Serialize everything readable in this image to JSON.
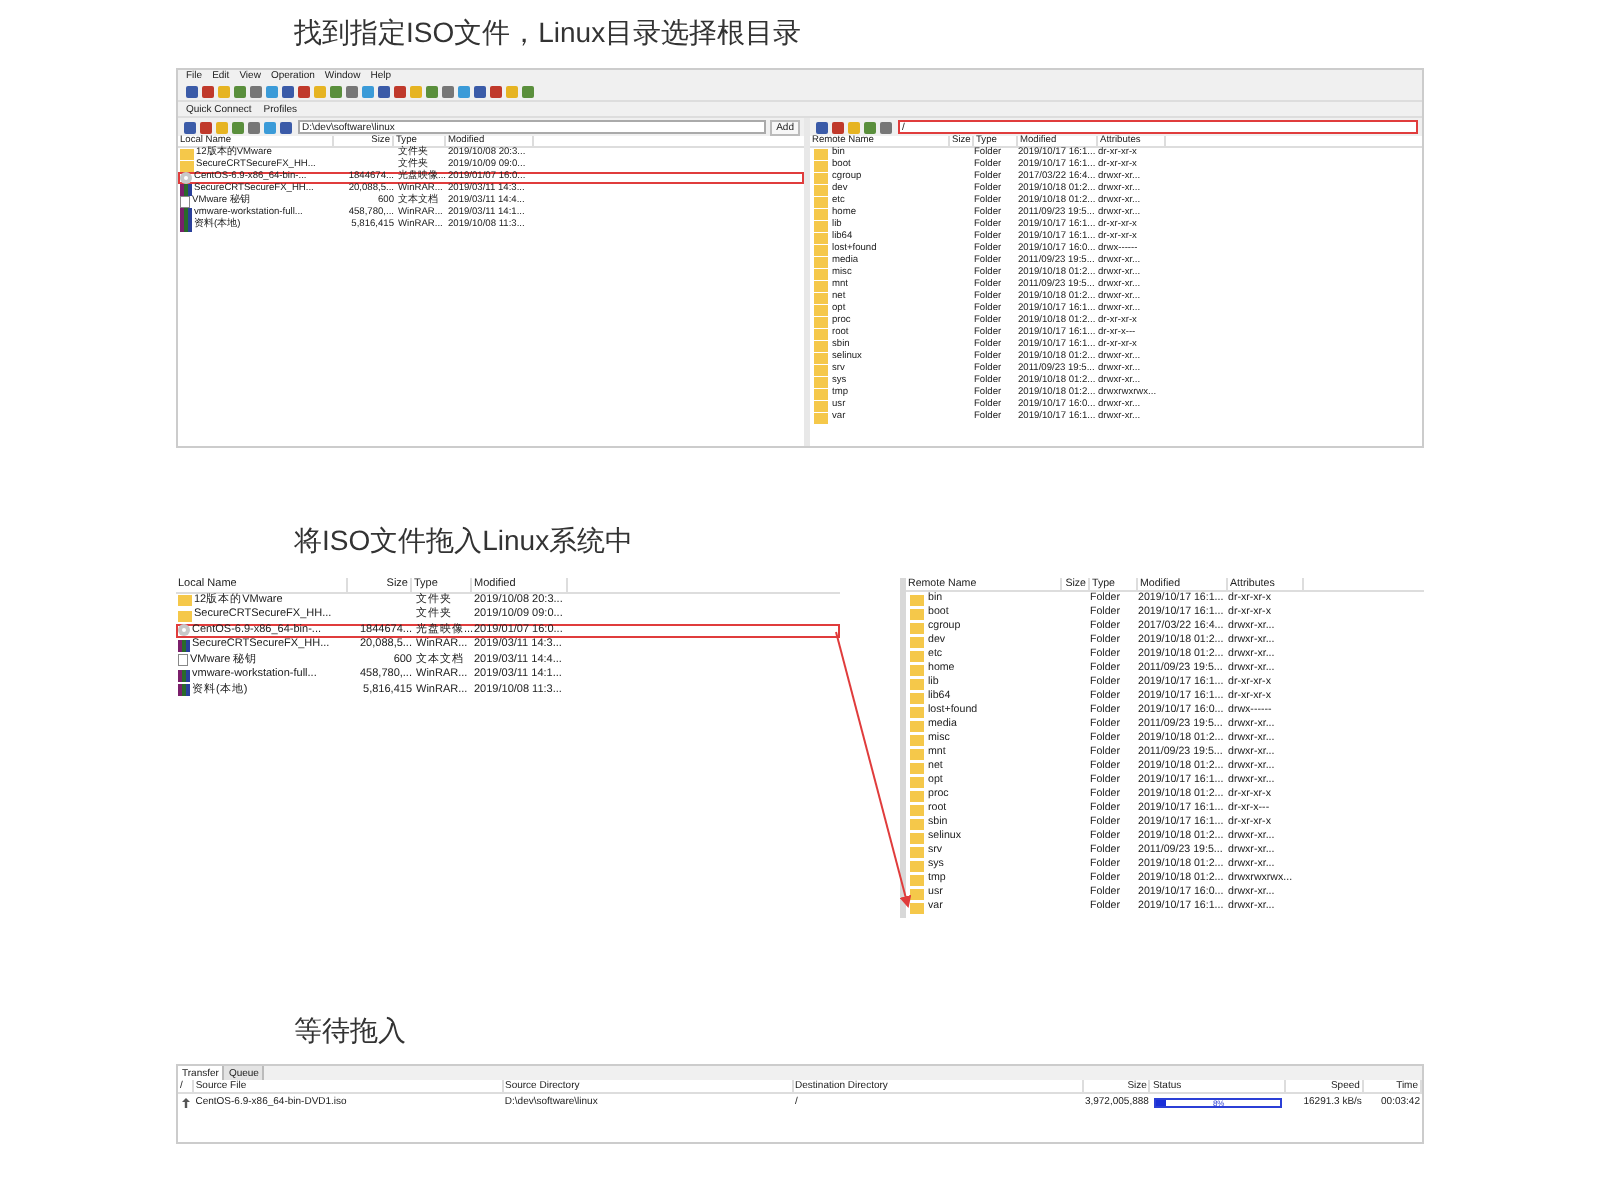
{
  "step1": {
    "heading": "找到指定ISO文件，Linux目录选择根目录",
    "menu": [
      "File",
      "Edit",
      "View",
      "Operation",
      "Window",
      "Help"
    ],
    "quick_connect": "Quick Connect",
    "profiles": "Profiles",
    "local_path": "D:\\dev\\software\\linux",
    "add_button": "Add",
    "remote_path": "/",
    "remote_path_highlighted": true,
    "local_columns": [
      "Local Name",
      "Size",
      "Type",
      "Modified"
    ],
    "local_files": [
      {
        "name": "12版本的VMware",
        "type": "文件夹",
        "modified": "2019/10/08 20:3...",
        "kind": "folder",
        "highlighted": false
      },
      {
        "name": "SecureCRTSecureFX_HH...",
        "type": "文件夹",
        "modified": "2019/10/09 09:0...",
        "kind": "folder",
        "highlighted": false
      },
      {
        "name": "CentOS-6.9-x86_64-bin-...",
        "size": "1844674...",
        "type": "光盘映像...",
        "modified": "2019/01/07 16:0...",
        "kind": "disc",
        "highlighted": true
      },
      {
        "name": "SecureCRTSecureFX_HH...",
        "size": "20,088,5...",
        "type": "WinRAR...",
        "modified": "2019/03/11 14:3...",
        "kind": "archive",
        "highlighted": false
      },
      {
        "name": "VMware 秘钥",
        "size": "600",
        "type": "文本文档",
        "modified": "2019/03/11 14:4...",
        "kind": "text",
        "highlighted": false
      },
      {
        "name": "vmware-workstation-full...",
        "size": "458,780,...",
        "type": "WinRAR...",
        "modified": "2019/03/11 14:1...",
        "kind": "archive",
        "highlighted": false
      },
      {
        "name": "资料(本地)",
        "size": "5,816,415",
        "type": "WinRAR...",
        "modified": "2019/10/08 11:3...",
        "kind": "archive",
        "highlighted": false
      }
    ],
    "remote_columns": [
      "Remote Name",
      "Size",
      "Type",
      "Modified",
      "Attributes"
    ],
    "remote_files": [
      {
        "name": "bin",
        "type": "Folder",
        "modified": "2019/10/17 16:1...",
        "attributes": "dr-xr-xr-x"
      },
      {
        "name": "boot",
        "type": "Folder",
        "modified": "2019/10/17 16:1...",
        "attributes": "dr-xr-xr-x"
      },
      {
        "name": "cgroup",
        "type": "Folder",
        "modified": "2017/03/22 16:4...",
        "attributes": "drwxr-xr..."
      },
      {
        "name": "dev",
        "type": "Folder",
        "modified": "2019/10/18 01:2...",
        "attributes": "drwxr-xr..."
      },
      {
        "name": "etc",
        "type": "Folder",
        "modified": "2019/10/18 01:2...",
        "attributes": "drwxr-xr..."
      },
      {
        "name": "home",
        "type": "Folder",
        "modified": "2011/09/23 19:5...",
        "attributes": "drwxr-xr..."
      },
      {
        "name": "lib",
        "type": "Folder",
        "modified": "2019/10/17 16:1...",
        "attributes": "dr-xr-xr-x"
      },
      {
        "name": "lib64",
        "type": "Folder",
        "modified": "2019/10/17 16:1...",
        "attributes": "dr-xr-xr-x"
      },
      {
        "name": "lost+found",
        "type": "Folder",
        "modified": "2019/10/17 16:0...",
        "attributes": "drwx------"
      },
      {
        "name": "media",
        "type": "Folder",
        "modified": "2011/09/23 19:5...",
        "attributes": "drwxr-xr..."
      },
      {
        "name": "misc",
        "type": "Folder",
        "modified": "2019/10/18 01:2...",
        "attributes": "drwxr-xr..."
      },
      {
        "name": "mnt",
        "type": "Folder",
        "modified": "2011/09/23 19:5...",
        "attributes": "drwxr-xr..."
      },
      {
        "name": "net",
        "type": "Folder",
        "modified": "2019/10/18 01:2...",
        "attributes": "drwxr-xr..."
      },
      {
        "name": "opt",
        "type": "Folder",
        "modified": "2019/10/17 16:1...",
        "attributes": "drwxr-xr..."
      },
      {
        "name": "proc",
        "type": "Folder",
        "modified": "2019/10/18 01:2...",
        "attributes": "dr-xr-xr-x"
      },
      {
        "name": "root",
        "type": "Folder",
        "modified": "2019/10/17 16:1...",
        "attributes": "dr-xr-x---"
      },
      {
        "name": "sbin",
        "type": "Folder",
        "modified": "2019/10/17 16:1...",
        "attributes": "dr-xr-xr-x"
      },
      {
        "name": "selinux",
        "type": "Folder",
        "modified": "2019/10/18 01:2...",
        "attributes": "drwxr-xr..."
      },
      {
        "name": "srv",
        "type": "Folder",
        "modified": "2011/09/23 19:5...",
        "attributes": "drwxr-xr..."
      },
      {
        "name": "sys",
        "type": "Folder",
        "modified": "2019/10/18 01:2...",
        "attributes": "drwxr-xr..."
      },
      {
        "name": "tmp",
        "type": "Folder",
        "modified": "2019/10/18 01:2...",
        "attributes": "drwxrwxrwx..."
      },
      {
        "name": "usr",
        "type": "Folder",
        "modified": "2019/10/17 16:0...",
        "attributes": "drwxr-xr..."
      },
      {
        "name": "var",
        "type": "Folder",
        "modified": "2019/10/17 16:1...",
        "attributes": "drwxr-xr..."
      }
    ]
  },
  "step2": {
    "heading": "将ISO文件拖入Linux系统中",
    "local_columns": [
      "Local Name",
      "Size",
      "Type",
      "Modified"
    ],
    "local_files": [
      {
        "name": "12版本的VMware",
        "type": "文件夹",
        "modified": "2019/10/08 20:3...",
        "kind": "folder",
        "highlighted": false
      },
      {
        "name": "SecureCRTSecureFX_HH...",
        "type": "文件夹",
        "modified": "2019/10/09 09:0...",
        "kind": "folder",
        "highlighted": false
      },
      {
        "name": "CentOS-6.9-x86_64-bin-...",
        "size": "1844674...",
        "type": "光盘映像...",
        "modified": "2019/01/07 16:0...",
        "kind": "disc",
        "highlighted": true
      },
      {
        "name": "SecureCRTSecureFX_HH...",
        "size": "20,088,5...",
        "type": "WinRAR...",
        "modified": "2019/03/11 14:3...",
        "kind": "archive",
        "highlighted": false
      },
      {
        "name": "VMware 秘钥",
        "size": "600",
        "type": "文本文档",
        "modified": "2019/03/11 14:4...",
        "kind": "text",
        "highlighted": false
      },
      {
        "name": "vmware-workstation-full...",
        "size": "458,780,...",
        "type": "WinRAR...",
        "modified": "2019/03/11 14:1...",
        "kind": "archive",
        "highlighted": false
      },
      {
        "name": "资料(本地)",
        "size": "5,816,415",
        "type": "WinRAR...",
        "modified": "2019/10/08 11:3...",
        "kind": "archive",
        "highlighted": false
      }
    ],
    "remote_columns": [
      "Remote Name",
      "Size",
      "Type",
      "Modified",
      "Attributes"
    ],
    "remote_files": [
      {
        "name": "bin",
        "type": "Folder",
        "modified": "2019/10/17 16:1...",
        "attributes": "dr-xr-xr-x"
      },
      {
        "name": "boot",
        "type": "Folder",
        "modified": "2019/10/17 16:1...",
        "attributes": "dr-xr-xr-x"
      },
      {
        "name": "cgroup",
        "type": "Folder",
        "modified": "2017/03/22 16:4...",
        "attributes": "drwxr-xr..."
      },
      {
        "name": "dev",
        "type": "Folder",
        "modified": "2019/10/18 01:2...",
        "attributes": "drwxr-xr..."
      },
      {
        "name": "etc",
        "type": "Folder",
        "modified": "2019/10/18 01:2...",
        "attributes": "drwxr-xr..."
      },
      {
        "name": "home",
        "type": "Folder",
        "modified": "2011/09/23 19:5...",
        "attributes": "drwxr-xr..."
      },
      {
        "name": "lib",
        "type": "Folder",
        "modified": "2019/10/17 16:1...",
        "attributes": "dr-xr-xr-x"
      },
      {
        "name": "lib64",
        "type": "Folder",
        "modified": "2019/10/17 16:1...",
        "attributes": "dr-xr-xr-x"
      },
      {
        "name": "lost+found",
        "type": "Folder",
        "modified": "2019/10/17 16:0...",
        "attributes": "drwx------"
      },
      {
        "name": "media",
        "type": "Folder",
        "modified": "2011/09/23 19:5...",
        "attributes": "drwxr-xr..."
      },
      {
        "name": "misc",
        "type": "Folder",
        "modified": "2019/10/18 01:2...",
        "attributes": "drwxr-xr..."
      },
      {
        "name": "mnt",
        "type": "Folder",
        "modified": "2011/09/23 19:5...",
        "attributes": "drwxr-xr..."
      },
      {
        "name": "net",
        "type": "Folder",
        "modified": "2019/10/18 01:2...",
        "attributes": "drwxr-xr..."
      },
      {
        "name": "opt",
        "type": "Folder",
        "modified": "2019/10/17 16:1...",
        "attributes": "drwxr-xr..."
      },
      {
        "name": "proc",
        "type": "Folder",
        "modified": "2019/10/18 01:2...",
        "attributes": "dr-xr-xr-x"
      },
      {
        "name": "root",
        "type": "Folder",
        "modified": "2019/10/17 16:1...",
        "attributes": "dr-xr-x---"
      },
      {
        "name": "sbin",
        "type": "Folder",
        "modified": "2019/10/17 16:1...",
        "attributes": "dr-xr-xr-x"
      },
      {
        "name": "selinux",
        "type": "Folder",
        "modified": "2019/10/18 01:2...",
        "attributes": "drwxr-xr..."
      },
      {
        "name": "srv",
        "type": "Folder",
        "modified": "2011/09/23 19:5...",
        "attributes": "drwxr-xr..."
      },
      {
        "name": "sys",
        "type": "Folder",
        "modified": "2019/10/18 01:2...",
        "attributes": "drwxr-xr..."
      },
      {
        "name": "tmp",
        "type": "Folder",
        "modified": "2019/10/18 01:2...",
        "attributes": "drwxrwxrwx..."
      },
      {
        "name": "usr",
        "type": "Folder",
        "modified": "2019/10/17 16:0...",
        "attributes": "drwxr-xr..."
      },
      {
        "name": "var",
        "type": "Folder",
        "modified": "2019/10/17 16:1...",
        "attributes": "drwxr-xr..."
      }
    ]
  },
  "step3": {
    "heading": "等待拖入",
    "tabs": [
      {
        "label": "Transfer",
        "selected": true
      },
      {
        "label": "Queue",
        "selected": false
      }
    ],
    "columns": [
      "/",
      "Source File",
      "Source Directory",
      "Destination Directory",
      "Size",
      "Status",
      "Speed",
      "Time"
    ],
    "transfer": {
      "source_file": "CentOS-6.9-x86_64-bin-DVD1.iso",
      "source_directory": "D:\\dev\\software\\linux",
      "destination": "/",
      "size": "3,972,005,888",
      "level": 0.08,
      "status": "8%",
      "speed": "16291.3 kB/s",
      "time": "00:03:42"
    }
  }
}
